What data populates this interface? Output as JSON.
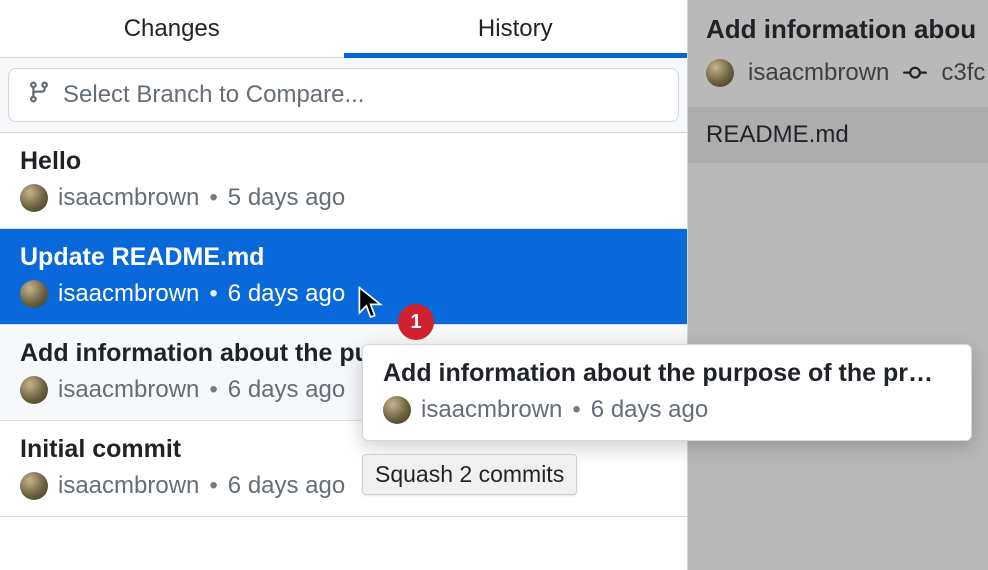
{
  "tabs": {
    "changes": "Changes",
    "history": "History",
    "active": "history"
  },
  "compare": {
    "placeholder": "Select Branch to Compare..."
  },
  "commits": [
    {
      "title": "Hello",
      "author": "isaacmbrown",
      "time": "5 days ago"
    },
    {
      "title": "Update README.md",
      "author": "isaacmbrown",
      "time": "6 days ago"
    },
    {
      "title": "Add information about the pu",
      "author": "isaacmbrown",
      "time": "6 days ago"
    },
    {
      "title": "Initial commit",
      "author": "isaacmbrown",
      "time": "6 days ago"
    }
  ],
  "drag": {
    "title": "Add information about the purpose of the pr…",
    "author": "isaacmbrown",
    "time": "6 days ago",
    "badge": "1",
    "tooltip": "Squash 2 commits"
  },
  "detail": {
    "title": "Add information abou",
    "author": "isaacmbrown",
    "sha": "c3fc",
    "file": "README.md"
  }
}
